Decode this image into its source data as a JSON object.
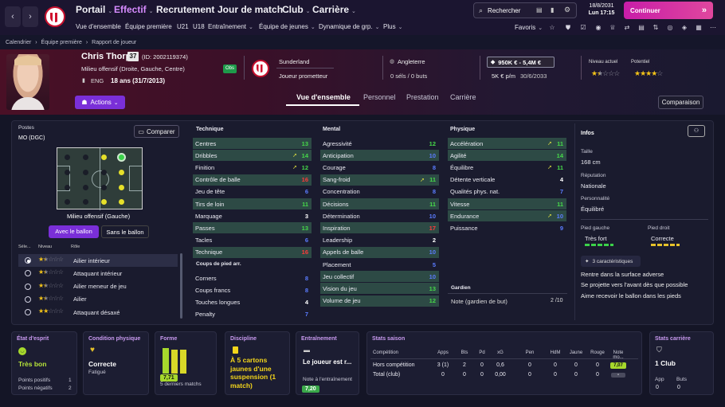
{
  "nav": {
    "main": [
      "Portail",
      "Effectif",
      "Recrutement",
      "Jour de match",
      "Club",
      "Carrière"
    ],
    "sub": [
      "Vue d'ensemble",
      "Équipe première",
      "U21",
      "U18",
      "Entraînement",
      "Équipe de jeunes",
      "Dynamique de grp.",
      "Plus"
    ],
    "search_label": "Rechercher",
    "date": "18/8/2031",
    "day_time": "Lun 17:15",
    "continue_label": "Continuer",
    "favorites_label": "Favoris"
  },
  "breadcrumbs": [
    "Calendrier",
    "Équipe première",
    "Rapport de joueur"
  ],
  "player": {
    "name": "Chris Thorpe",
    "number": "37",
    "id": "(ID: 2002119374)",
    "position": "Milieu offensif (Droite, Gauche, Centre)",
    "nationality": "ENG",
    "age": "18 ans (31/7/2013)",
    "obs_badge": "Obs",
    "club": "Sunderland",
    "status": "Joueur prometteur",
    "nation": "Angleterre",
    "caps": "0 séls / 0 buts",
    "value": "950K € - 5,4M €",
    "wage": "5K € p/m",
    "contract": "30/6/2033",
    "current_level_label": "Niveau actuel",
    "potential_label": "Potentiel",
    "current_stars": 1.5,
    "potential_stars": 4,
    "actions_label": "Actions",
    "compare_label": "Comparaison"
  },
  "tabs": [
    "Vue d'ensemble",
    "Personnel",
    "Prestation",
    "Carrière"
  ],
  "positions": {
    "title": "Postes",
    "current": "MO (DGC)",
    "compare_label": "Comparer",
    "role_caption": "Milieu offensif (Gauche)",
    "toggle": [
      "Avec le ballon",
      "Sans le ballon"
    ],
    "headers": [
      "Séle...",
      "Niveau",
      "Rôle"
    ],
    "roles": [
      {
        "name": "Ailier intérieur",
        "stars": 1.5,
        "selected": true
      },
      {
        "name": "Attaquant intérieur",
        "stars": 1.5,
        "selected": false
      },
      {
        "name": "Ailier meneur de jeu",
        "stars": 1.5,
        "selected": false
      },
      {
        "name": "Ailier",
        "stars": 1.5,
        "selected": false
      },
      {
        "name": "Attaquant désaxé",
        "stars": 2,
        "selected": false
      }
    ]
  },
  "technique": {
    "title": "Technique",
    "rows": [
      {
        "label": "Centres",
        "value": "13",
        "color": "green",
        "hl": true
      },
      {
        "label": "Dribbles",
        "value": "14",
        "color": "green",
        "hl": true,
        "arrow": true
      },
      {
        "label": "Finition",
        "value": "12",
        "color": "green",
        "hl": false,
        "arrow": true
      },
      {
        "label": "Contrôle de balle",
        "value": "16",
        "color": "red",
        "hl": true
      },
      {
        "label": "Jeu de tête",
        "value": "6",
        "color": "blue",
        "hl": false
      },
      {
        "label": "Tirs de loin",
        "value": "11",
        "color": "green",
        "hl": true
      },
      {
        "label": "Marquage",
        "value": "3",
        "color": "white",
        "hl": false
      },
      {
        "label": "Passes",
        "value": "13",
        "color": "green",
        "hl": true
      },
      {
        "label": "Tacles",
        "value": "6",
        "color": "blue",
        "hl": false
      },
      {
        "label": "Technique",
        "value": "16",
        "color": "red",
        "hl": true
      }
    ],
    "setpieces_title": "Coups de pied arr.",
    "setpieces": [
      {
        "label": "Corners",
        "value": "8",
        "color": "blue"
      },
      {
        "label": "Coups francs",
        "value": "8",
        "color": "blue"
      },
      {
        "label": "Touches longues",
        "value": "4",
        "color": "white"
      },
      {
        "label": "Penalty",
        "value": "7",
        "color": "blue"
      }
    ]
  },
  "mental": {
    "title": "Mental",
    "rows": [
      {
        "label": "Agressivité",
        "value": "12",
        "color": "green",
        "hl": false
      },
      {
        "label": "Anticipation",
        "value": "10",
        "color": "blue",
        "hl": true
      },
      {
        "label": "Courage",
        "value": "8",
        "color": "blue",
        "hl": false
      },
      {
        "label": "Sang-froid",
        "value": "11",
        "color": "green",
        "hl": true,
        "arrow": true
      },
      {
        "label": "Concentration",
        "value": "8",
        "color": "blue",
        "hl": false
      },
      {
        "label": "Décisions",
        "value": "11",
        "color": "green",
        "hl": true
      },
      {
        "label": "Détermination",
        "value": "10",
        "color": "blue",
        "hl": false
      },
      {
        "label": "Inspiration",
        "value": "17",
        "color": "red",
        "hl": true
      },
      {
        "label": "Leadership",
        "value": "2",
        "color": "white",
        "hl": false
      },
      {
        "label": "Appels de balle",
        "value": "10",
        "color": "blue",
        "hl": true
      },
      {
        "label": "Placement",
        "value": "5",
        "color": "blue",
        "hl": false
      },
      {
        "label": "Jeu collectif",
        "value": "10",
        "color": "blue",
        "hl": true
      },
      {
        "label": "Vision du jeu",
        "value": "13",
        "color": "green",
        "hl": true
      },
      {
        "label": "Volume de jeu",
        "value": "12",
        "color": "green",
        "hl": true
      }
    ]
  },
  "physique": {
    "title": "Physique",
    "rows": [
      {
        "label": "Accélération",
        "value": "11",
        "color": "green",
        "hl": true,
        "arrow": true
      },
      {
        "label": "Agilité",
        "value": "14",
        "color": "green",
        "hl": true
      },
      {
        "label": "Équilibre",
        "value": "11",
        "color": "green",
        "hl": false,
        "arrow": true
      },
      {
        "label": "Détente verticale",
        "value": "4",
        "color": "white",
        "hl": false
      },
      {
        "label": "Qualités phys. nat.",
        "value": "7",
        "color": "blue",
        "hl": false
      },
      {
        "label": "Vitesse",
        "value": "11",
        "color": "green",
        "hl": true
      },
      {
        "label": "Endurance",
        "value": "10",
        "color": "blue",
        "hl": true,
        "arrow": true
      },
      {
        "label": "Puissance",
        "value": "9",
        "color": "blue",
        "hl": false
      }
    ],
    "gk_title": "Gardien",
    "gk_label": "Note (gardien de but)",
    "gk_value": "2 /10"
  },
  "info": {
    "title": "Infos",
    "height_label": "Taille",
    "height": "168 cm",
    "rep_label": "Réputation",
    "rep": "Nationale",
    "pers_label": "Personnalité",
    "pers": "Équilibré",
    "lfoot_label": "Pied gauche",
    "lfoot": "Très fort",
    "rfoot_label": "Pied droit",
    "rfoot": "Correcte",
    "traits_badge": "3 caractéristiques",
    "traits": [
      "Rentre dans la surface adverse",
      "Se projette vers l'avant dès que possible",
      "Aime recevoir le ballon dans les pieds"
    ]
  },
  "cards": {
    "mood_title": "État d'esprit",
    "mood": "Très bon",
    "pos_points_label": "Points positifs",
    "pos_points": "1",
    "neg_points_label": "Points négatifs",
    "neg_points": "2",
    "cond_title": "Condition physique",
    "cond": "Correcte",
    "cond_sub": "Fatigué",
    "form_title": "Forme",
    "form_value": "7,71",
    "form_sub": "5 derniers matchs",
    "disc_title": "Discipline",
    "disc_text": "À 5 cartons jaunes d'une suspension (1 match)",
    "train_title": "Entraînement",
    "train_text": "Le joueur est r...",
    "train_sub": "Note à l'entraînement",
    "train_value": "7,20",
    "season_title": "Stats saison",
    "season_headers": [
      "Compétition",
      "Apps",
      "Bts",
      "Pd",
      "xG",
      "Pen",
      "HdM",
      "Jaune",
      "Rouge",
      "Note mo..."
    ],
    "season_rows": [
      [
        "Hors compétition",
        "3 (1)",
        "2",
        "0",
        "0,6",
        "0",
        "0",
        "0",
        "0",
        "7,07"
      ],
      [
        "Total (club)",
        "0",
        "0",
        "0",
        "0,00",
        "0",
        "0",
        "0",
        "0",
        "-"
      ]
    ],
    "career_title": "Stats carrière",
    "career_clubs": "1 Club",
    "career_app_label": "App",
    "career_app": "0",
    "career_goals_label": "Buts",
    "career_goals": "0"
  }
}
